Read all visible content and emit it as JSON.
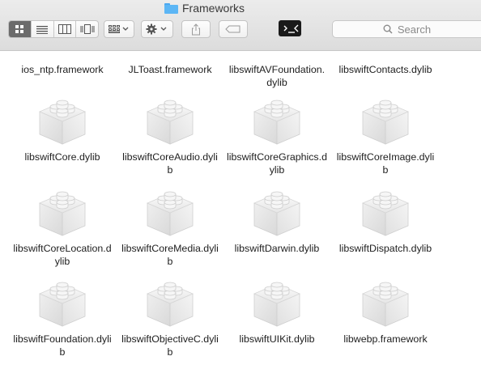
{
  "window": {
    "title": "Frameworks"
  },
  "toolbar": {
    "view_modes": [
      "icon-view",
      "list-view",
      "column-view",
      "cover-flow-view"
    ],
    "search_placeholder": "Search"
  },
  "top_row": [
    {
      "name": "ios_ntp.framework"
    },
    {
      "name": "JLToast.framework"
    },
    {
      "name": "libswiftAVFoundation.dylib"
    },
    {
      "name": "libswiftContacts.dylib"
    }
  ],
  "items": [
    {
      "name": "libswiftCore.dylib"
    },
    {
      "name": "libswiftCoreAudio.dylib"
    },
    {
      "name": "libswiftCoreGraphics.dylib"
    },
    {
      "name": "libswiftCoreImage.dylib"
    },
    {
      "name": "libswiftCoreLocation.dylib"
    },
    {
      "name": "libswiftCoreMedia.dylib"
    },
    {
      "name": "libswiftDarwin.dylib"
    },
    {
      "name": "libswiftDispatch.dylib"
    },
    {
      "name": "libswiftFoundation.dylib"
    },
    {
      "name": "libswiftObjectiveC.dylib"
    },
    {
      "name": "libswiftUIKit.dylib"
    },
    {
      "name": "libwebp.framework"
    }
  ]
}
